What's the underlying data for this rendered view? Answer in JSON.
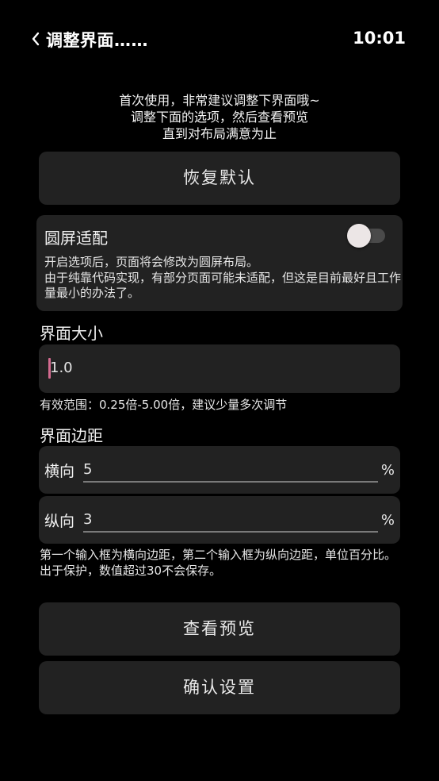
{
  "header": {
    "title": "调整界面……",
    "time": "10:01"
  },
  "intro": {
    "line1": "首次使用，非常建议调整下界面哦~",
    "line2": "调整下面的选项，然后查看预览",
    "line3": "直到对布局满意为止"
  },
  "buttons": {
    "reset": "恢复默认",
    "preview": "查看预览",
    "confirm": "确认设置"
  },
  "round_screen": {
    "title": "圆屏适配",
    "desc_line1": "开启选项后，页面将会修改为圆屏布局。",
    "desc_line2": "由于纯靠代码实现，有部分页面可能未适配，但这是目前最好且工作量最小的办法了。",
    "enabled": false
  },
  "ui_size": {
    "label": "界面大小",
    "value": "1.0",
    "hint": "有效范围：0.25倍-5.00倍，建议少量多次调节"
  },
  "ui_margin": {
    "label": "界面边距",
    "horizontal_label": "横向",
    "horizontal_value": "5",
    "vertical_label": "纵向",
    "vertical_value": "3",
    "unit": "%",
    "hint_line1": "第一个输入框为横向边距，第二个输入框为纵向边距，单位百分比。",
    "hint_line2": "出于保护，数值超过30不会保存。"
  },
  "colors": {
    "background": "#000000",
    "card": "#222222",
    "caret": "#d36a8f"
  },
  "icons": {
    "back": "chevron-left-icon"
  }
}
